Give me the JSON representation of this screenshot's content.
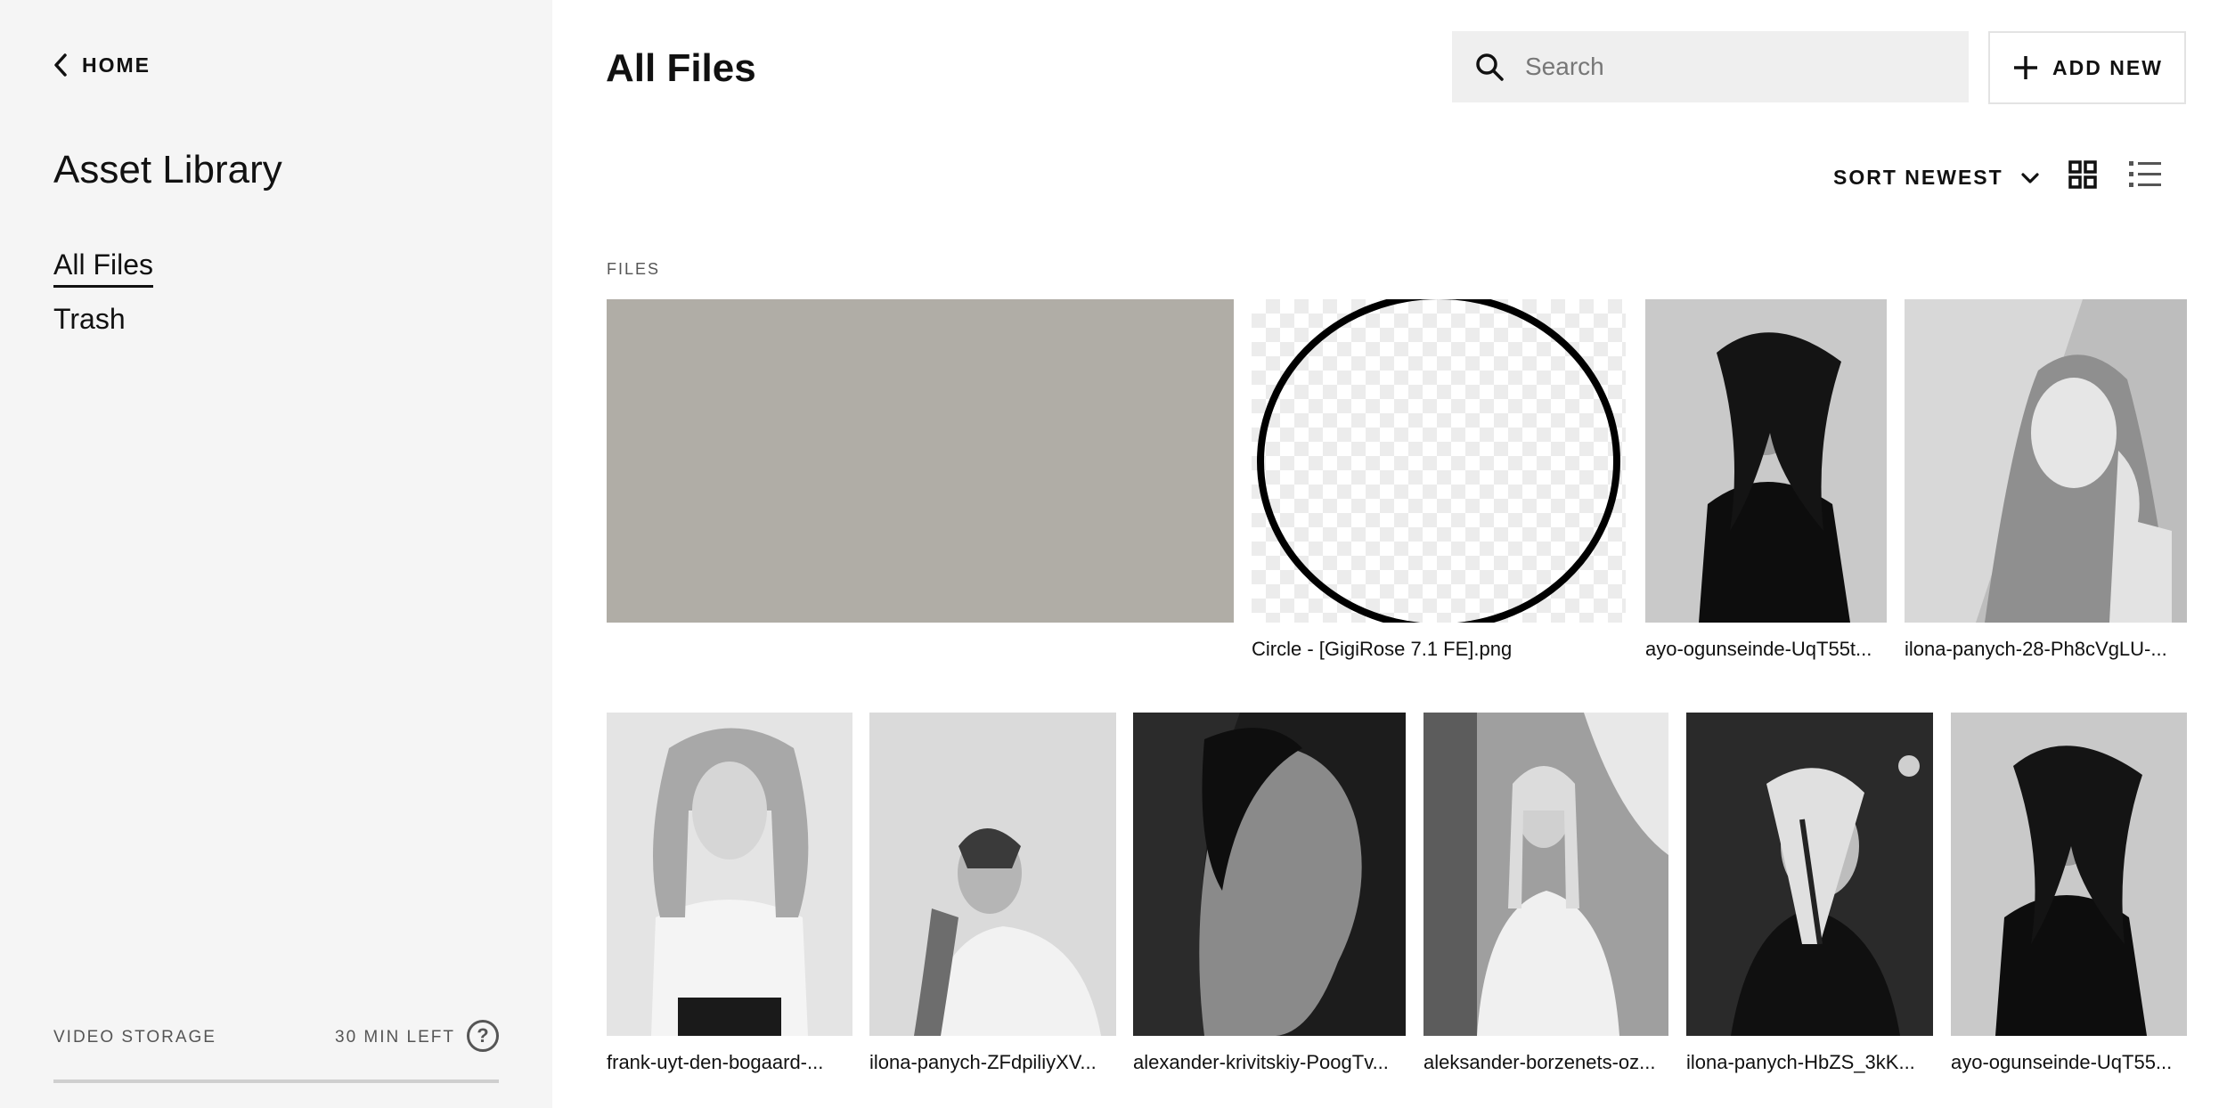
{
  "sidebar": {
    "home_label": "HOME",
    "title": "Asset Library",
    "nav": [
      {
        "label": "All Files",
        "active": true
      },
      {
        "label": "Trash",
        "active": false
      }
    ],
    "storage": {
      "label": "VIDEO STORAGE",
      "remaining": "30 MIN LEFT",
      "help_icon": "question-circle-icon"
    }
  },
  "header": {
    "title": "All Files",
    "search_placeholder": "Search",
    "search_value": "",
    "add_label": "ADD NEW",
    "sort_label": "SORT NEWEST",
    "views": [
      "grid-view-icon",
      "list-view-icon"
    ],
    "active_view": "grid"
  },
  "files": {
    "section_label": "FILES",
    "row1": [
      {
        "name": "",
        "kind": "solid",
        "color": "#b0ada6"
      },
      {
        "name": "Circle - [GigiRose 7.1 FE].png",
        "kind": "transparent-circle"
      },
      {
        "name": "ayo-ogunseinde-UqT55t...",
        "kind": "photo"
      },
      {
        "name": "ilona-panych-28-Ph8cVgLU-...",
        "kind": "photo"
      }
    ],
    "row2": [
      {
        "name": "frank-uyt-den-bogaard-...",
        "kind": "photo"
      },
      {
        "name": "ilona-panych-ZFdpiliyXV...",
        "kind": "photo"
      },
      {
        "name": "alexander-krivitskiy-PoogTv...",
        "kind": "photo"
      },
      {
        "name": "aleksander-borzenets-oz...",
        "kind": "photo"
      },
      {
        "name": "ilona-panych-HbZS_3kK...",
        "kind": "photo"
      },
      {
        "name": "ayo-ogunseinde-UqT55...",
        "kind": "photo"
      }
    ]
  }
}
